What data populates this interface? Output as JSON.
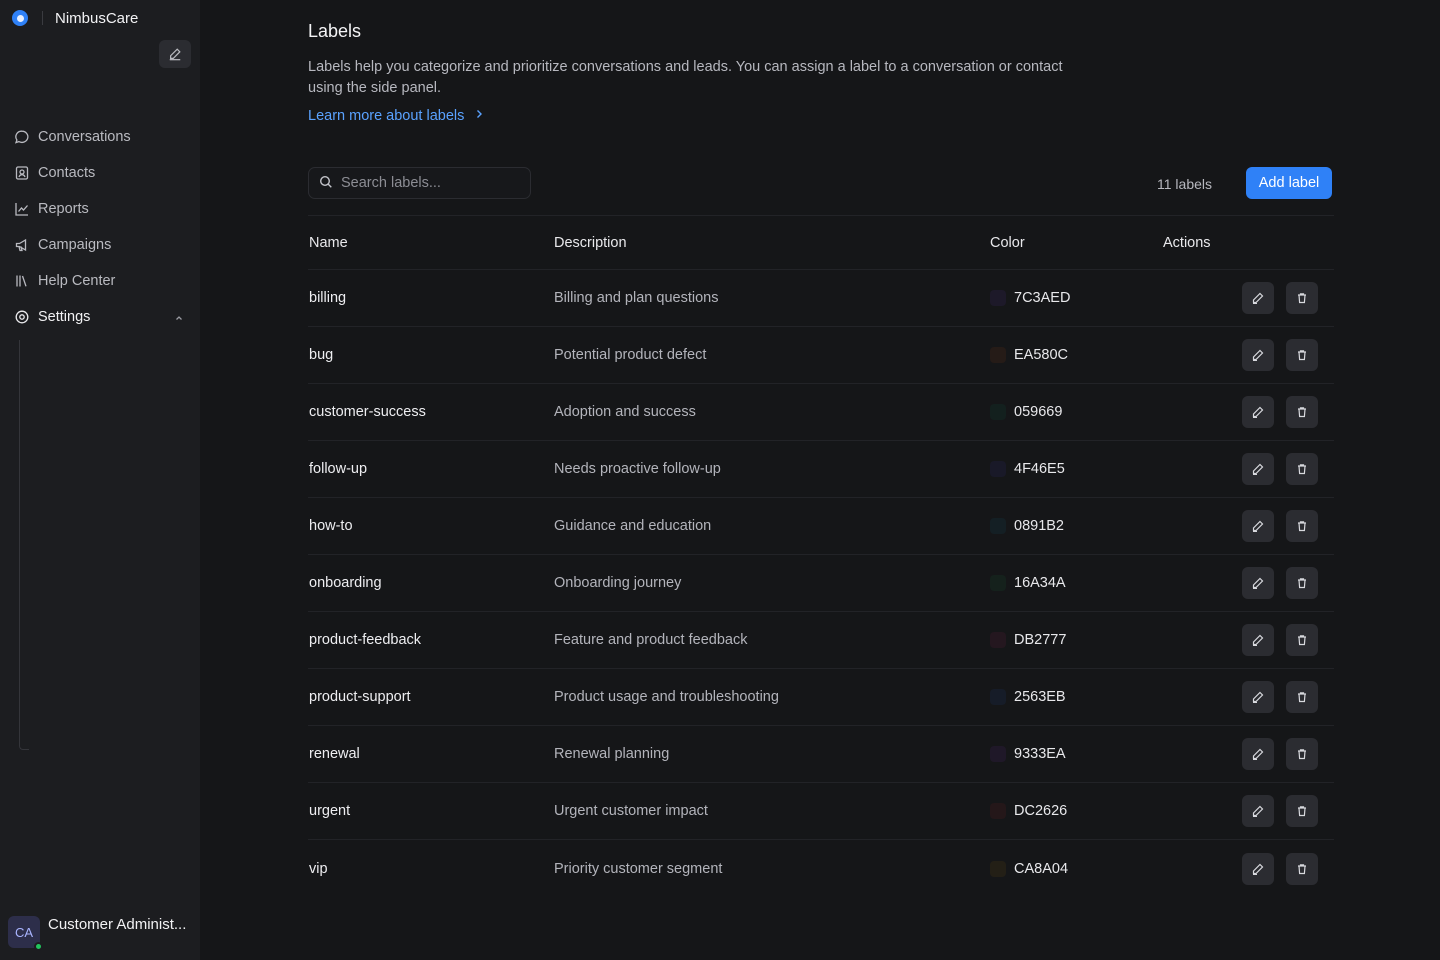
{
  "brand": {
    "name": "NimbusCare"
  },
  "nav": {
    "items": [
      {
        "label": "Conversations",
        "icon": "chat-bubble-icon"
      },
      {
        "label": "Contacts",
        "icon": "contact-card-icon"
      },
      {
        "label": "Reports",
        "icon": "line-chart-icon"
      },
      {
        "label": "Campaigns",
        "icon": "megaphone-icon"
      },
      {
        "label": "Help Center",
        "icon": "library-icon"
      },
      {
        "label": "Settings",
        "icon": "gear-icon"
      }
    ]
  },
  "user": {
    "initials": "CA",
    "name": "Customer Administ...",
    "status_color": "#22c55e"
  },
  "page": {
    "title": "Labels",
    "description": "Labels help you categorize and prioritize conversations and leads. You can assign a label to a conversation or contact using the side panel.",
    "learn_more": "Learn more about labels"
  },
  "toolbar": {
    "search_placeholder": "Search labels...",
    "count": "11 labels",
    "add_label": "Add label"
  },
  "table": {
    "headers": {
      "name": "Name",
      "description": "Description",
      "color": "Color",
      "actions": "Actions"
    },
    "rows": [
      {
        "name": "billing",
        "description": "Billing and plan questions",
        "color": "7C3AED"
      },
      {
        "name": "bug",
        "description": "Potential product defect",
        "color": "EA580C"
      },
      {
        "name": "customer-success",
        "description": "Adoption and success",
        "color": "059669"
      },
      {
        "name": "follow-up",
        "description": "Needs proactive follow-up",
        "color": "4F46E5"
      },
      {
        "name": "how-to",
        "description": "Guidance and education",
        "color": "0891B2"
      },
      {
        "name": "onboarding",
        "description": "Onboarding journey",
        "color": "16A34A"
      },
      {
        "name": "product-feedback",
        "description": "Feature and product feedback",
        "color": "DB2777"
      },
      {
        "name": "product-support",
        "description": "Product usage and troubleshooting",
        "color": "2563EB"
      },
      {
        "name": "renewal",
        "description": "Renewal planning",
        "color": "9333EA"
      },
      {
        "name": "urgent",
        "description": "Urgent customer impact",
        "color": "DC2626"
      },
      {
        "name": "vip",
        "description": "Priority customer segment",
        "color": "CA8A04"
      }
    ]
  },
  "colors": {
    "accent": "#2f81f7",
    "link": "#5aa2ff",
    "background": "#151618",
    "sidebar": "#1c1d20"
  }
}
